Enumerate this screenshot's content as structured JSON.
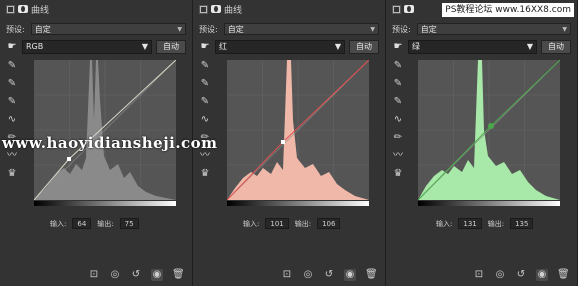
{
  "watermarks": {
    "site_url": "www.haoyidiansheji.com",
    "forum": "PS教程论坛 www.16XX8.com"
  },
  "panels": [
    {
      "title": "曲线",
      "preset_label": "预设:",
      "preset_value": "自定",
      "channel": "RGB",
      "auto_label": "自动",
      "input_label": "输入:",
      "input_value": "64",
      "output_label": "输出:",
      "output_value": "75",
      "curve_color": "#d8d8c8",
      "hist_color": "#8a8a8a"
    },
    {
      "title": "曲线",
      "preset_label": "预设:",
      "preset_value": "自定",
      "channel": "红",
      "auto_label": "自动",
      "input_label": "输入:",
      "input_value": "101",
      "output_label": "输出:",
      "output_value": "106",
      "curve_color": "#e05050",
      "hist_color": "#f0b8a8"
    },
    {
      "title": "",
      "preset_label": "预设:",
      "preset_value": "自定",
      "channel": "绿",
      "auto_label": "自动",
      "input_label": "输入:",
      "input_value": "131",
      "output_label": "输出:",
      "output_value": "135",
      "curve_color": "#4ca84c",
      "hist_color": "#a8e8a8"
    }
  ],
  "icons": {
    "hand": "pointing-hand-icon",
    "eyedropper_black": "eyedropper-icon",
    "curve_tool": "curve-tool-icon",
    "pencil": "pencil-icon",
    "clip": "clip-icon"
  }
}
